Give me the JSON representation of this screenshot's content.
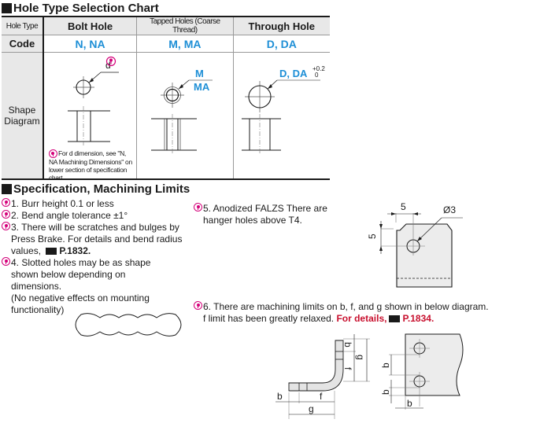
{
  "hole_chart": {
    "title": "Hole Type Selection Chart",
    "header": {
      "col0": "Hole Type",
      "col1": "Bolt Hole",
      "col2": "Tapped Holes (Coarse Thread)",
      "col3": "Through Hole"
    },
    "code_row": {
      "label": "Code",
      "col1": "N, NA",
      "col2": "M, MA",
      "col3": "D, DA"
    },
    "shape_row": {
      "label_line1": "Shape",
      "label_line2": "Diagram",
      "bolt_dim_label": "d",
      "tapped_dim_line1": "M",
      "tapped_dim_line2": "MA",
      "through_dim_label": "D, DA",
      "through_tol_upper": "+0.2",
      "through_tol_lower": "0",
      "bolt_note": "For d dimension, see \"N, NA Machining Dimensions\" on lower section of specification chart."
    }
  },
  "spec": {
    "title": "Specification, Machining Limits",
    "items": [
      {
        "text": "1. Burr height 0.1 or less"
      },
      {
        "text": "2. Bend angle tolerance ±1°"
      },
      {
        "text": "3. There will be scratches and bulges by Press Brake. For details and bend radius values,",
        "ref": "P.1832."
      },
      {
        "text": "4. Slotted holes may be as shape shown below depending on dimensions.",
        "sub": "(No negative effects on mounting functionality)"
      },
      {
        "text": "5. Anodized FALZS There are hanger holes above T4."
      },
      {
        "text": "6. There are machining limits on b, f, and g shown in below diagram. f limit has been greatly relaxed.",
        "ref_prefix": "For details,",
        "ref": "P.1834."
      }
    ],
    "hanger_diagram": {
      "dim_h": "5",
      "dim_v": "5",
      "hole": "Ø3"
    },
    "bend_diagram": {
      "labels": [
        "b",
        "f",
        "g",
        "b",
        "f",
        "g"
      ]
    },
    "plate_diagram": {
      "labels": [
        "b",
        "b",
        "b"
      ]
    }
  },
  "colors": {
    "accent_blue": "#1e8fd6",
    "accent_red": "#c8102e",
    "pin_magenta": "#d4007a"
  }
}
